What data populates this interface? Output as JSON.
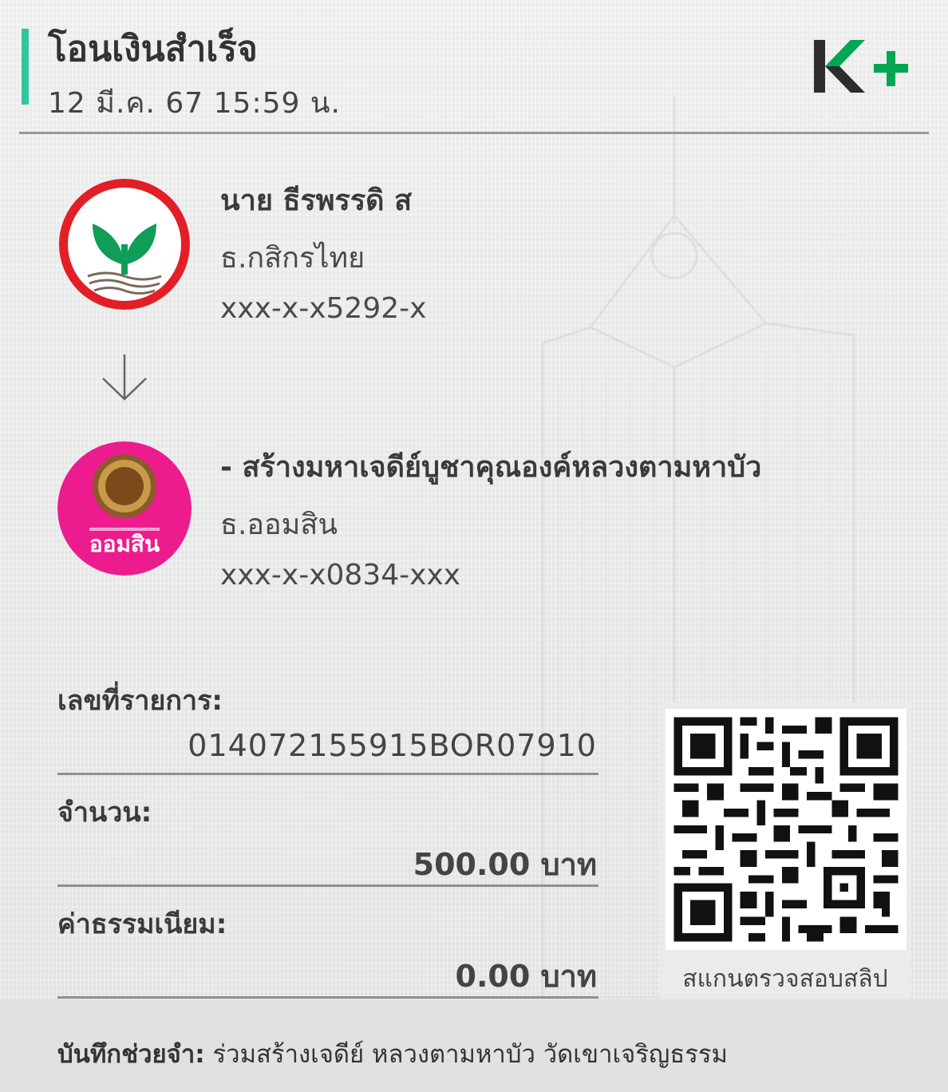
{
  "header": {
    "title": "โอนเงินสำเร็จ",
    "datetime": "12 มี.ค. 67  15:59 น.",
    "accent_color": "#2fc59f",
    "brand_logo": "K+"
  },
  "sender": {
    "name": "นาย ธีรพรรดิ ส",
    "bank": "ธ.กสิกรไทย",
    "account": "xxx-x-x5292-x",
    "logo_icon": "kasikornbank-logo"
  },
  "receiver": {
    "name": "- สร้างมหาเจดีย์บูชาคุณองค์หลวงตามหาบัว",
    "bank": "ธ.ออมสิน",
    "account": "xxx-x-x0834-xxx",
    "logo_icon": "government-savings-bank-logo",
    "logo_text": "ออมสิน"
  },
  "details": {
    "transaction_id_label": "เลขที่รายการ:",
    "transaction_id": "014072155915BOR07910",
    "amount_label": "จำนวน:",
    "amount": "500.00 บาท",
    "fee_label": "ค่าธรรมเนียม:",
    "fee": "0.00 บาท"
  },
  "qr": {
    "caption": "สแกนตรวจสอบสลิป"
  },
  "footer": {
    "memo_label": "บันทึกช่วยจำ:",
    "memo_text": "ร่วมสร้างเจดีย์ หลวงตามหาบัว วัดเขาเจริญธรรม"
  },
  "colors": {
    "kbank_green": "#0f9d58",
    "kbank_red": "#e21f26",
    "gsb_pink": "#ec1c8e",
    "kplus_green": "#00a651"
  }
}
